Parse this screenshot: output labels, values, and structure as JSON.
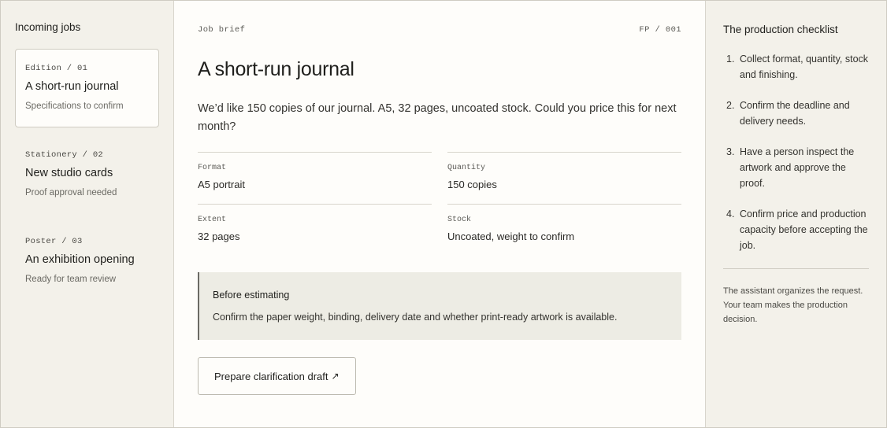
{
  "sidebar": {
    "title": "Incoming jobs",
    "jobs": [
      {
        "tag": "Edition / 01",
        "title": "A short-run journal",
        "status": "Specifications to confirm"
      },
      {
        "tag": "Stationery / 02",
        "title": "New studio cards",
        "status": "Proof approval needed"
      },
      {
        "tag": "Poster / 03",
        "title": "An exhibition opening",
        "status": "Ready for team review"
      }
    ]
  },
  "main": {
    "section": "Job brief",
    "ref": "FP / 001",
    "title": "A short-run journal",
    "description": "We’d like 150 copies of our journal. A5, 32 pages, uncoated stock. Could you price this for next month?",
    "specs": [
      {
        "label": "Format",
        "value": "A5 portrait"
      },
      {
        "label": "Quantity",
        "value": "150 copies"
      },
      {
        "label": "Extent",
        "value": "32 pages"
      },
      {
        "label": "Stock",
        "value": "Uncoated, weight to confirm"
      }
    ],
    "notice": {
      "title": "Before estimating",
      "text": "Confirm the paper weight, binding, delivery date and whether print-ready artwork is available."
    },
    "cta_label": "Prepare clarification draft",
    "cta_icon": "↗"
  },
  "checklist": {
    "title": "The production checklist",
    "items": [
      {
        "num": "1.",
        "text": "Collect format, quantity, stock and finishing."
      },
      {
        "num": "2.",
        "text": "Confirm the deadline and delivery needs."
      },
      {
        "num": "3.",
        "text": "Have a person inspect the artwork and approve the proof."
      },
      {
        "num": "4.",
        "text": "Confirm price and production capacity before accepting the job."
      }
    ],
    "note": "The assistant organizes the request. Your team makes the production decision."
  }
}
